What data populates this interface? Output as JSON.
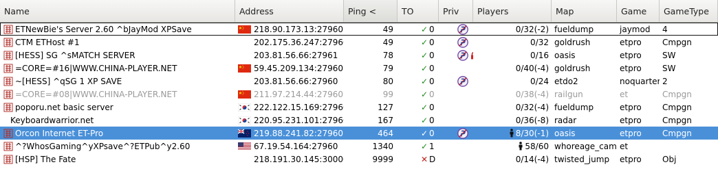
{
  "columns": {
    "name": "Name",
    "address": "Address",
    "ping": "Ping <",
    "to": "TO",
    "priv": "Priv",
    "players": "Players",
    "map": "Map",
    "game": "Game",
    "gametype": "GameType"
  },
  "colors": {
    "selection": "#4a90d9",
    "ok_mark": "#1f8b1f",
    "fail_mark": "#c4211b",
    "dim_text": "#9a9a9a"
  },
  "servers": [
    {
      "name": "ETNewBie's Server 2.60 ^bJayMod XPSave",
      "flag": "cn",
      "address": "218.90.173.13:27960",
      "ping": "49",
      "status": "ok",
      "timeouts": "0",
      "punkbuster": true,
      "password": false,
      "human_players": false,
      "players": "0/32(-2)",
      "map": "fueldump",
      "game": "jaymod",
      "gametype": "4",
      "state": "focused"
    },
    {
      "name": "CTM ETHost #1",
      "flag": "",
      "address": "202.175.36.247:27960",
      "ping": "49",
      "status": "ok",
      "timeouts": "0",
      "punkbuster": true,
      "password": false,
      "human_players": false,
      "players": "0/32",
      "map": "goldrush",
      "game": "etpro",
      "gametype": "Cmpgn",
      "state": ""
    },
    {
      "name": "[HESS] SG ^sMATCH SERVER",
      "flag": "",
      "address": "203.81.56.66:27961",
      "ping": "78",
      "status": "ok",
      "timeouts": "0",
      "punkbuster": true,
      "password": true,
      "human_players": false,
      "players": "0/16",
      "map": "oasis",
      "game": "etpro",
      "gametype": "SW",
      "state": ""
    },
    {
      "name": "=CORE=#16|WWW.CHINA-PLAYER.NET",
      "flag": "cn",
      "address": "59.45.209.134:27960",
      "ping": "79",
      "status": "ok",
      "timeouts": "0",
      "punkbuster": false,
      "password": false,
      "human_players": false,
      "players": "0/40(-4)",
      "map": "goldrush",
      "game": "etpro",
      "gametype": "SW",
      "state": ""
    },
    {
      "name": "~[HESS] ^qSG 1 XP SAVE",
      "flag": "",
      "address": "203.81.56.66:27960",
      "ping": "80",
      "status": "ok",
      "timeouts": "0",
      "punkbuster": true,
      "password": false,
      "human_players": false,
      "players": "0/24",
      "map": "etdo2",
      "game": "noquarter",
      "gametype": "2",
      "state": ""
    },
    {
      "name": "=CORE=#08|WWW.CHINA-PLAYER.NET",
      "flag": "cn",
      "address": "211.97.214.44:27960",
      "ping": "99",
      "status": "ok",
      "timeouts": "0",
      "punkbuster": false,
      "password": false,
      "human_players": false,
      "players": "0/38(-4)",
      "map": "railgun",
      "game": "et",
      "gametype": "Cmpgn",
      "state": "dim"
    },
    {
      "name": "poporu.net basic server",
      "flag": "kr",
      "address": "222.122.15.169:27960",
      "ping": "127",
      "status": "ok",
      "timeouts": "0",
      "punkbuster": false,
      "password": false,
      "human_players": false,
      "players": "0/32(-4)",
      "map": "fueldump",
      "game": "etpro",
      "gametype": "Cmpgn",
      "state": ""
    },
    {
      "name": "Keyboardwarrior.net",
      "flag": "kr",
      "address": "220.95.231.101:27960",
      "ping": "167",
      "status": "ok",
      "timeouts": "0",
      "punkbuster": false,
      "password": false,
      "human_players": false,
      "players": "0/36(-8)",
      "map": "radar",
      "game": "etpro",
      "gametype": "Cmpgn",
      "state": "",
      "no_game_icon": true
    },
    {
      "name": "Orcon Internet ET-Pro",
      "flag": "nz",
      "address": "219.88.241.82:27960",
      "ping": "464",
      "status": "ok",
      "timeouts": "0",
      "punkbuster": true,
      "password": false,
      "human_players": true,
      "players": "8/30(-1)",
      "map": "oasis",
      "game": "etpro",
      "gametype": "Cmpgn",
      "state": "selected"
    },
    {
      "name": "^?WhosGaming^yXPsave^?ETPub^y2.60",
      "flag": "us",
      "address": "67.19.54.164:27960",
      "ping": "1340",
      "status": "ok",
      "timeouts": "1",
      "punkbuster": false,
      "password": false,
      "human_players": true,
      "players": "58/60",
      "map": "whoreage_camp",
      "game": "et",
      "gametype": "",
      "state": ""
    },
    {
      "name": "[HSP] The Fate",
      "flag": "",
      "address": "218.191.30.145:30000",
      "ping": "9999",
      "status": "fail",
      "timeouts": "D",
      "punkbuster": false,
      "password": false,
      "human_players": false,
      "players": "0/14(-4)",
      "map": "twisted_jump",
      "game": "etpro",
      "gametype": "Obj",
      "state": ""
    }
  ]
}
